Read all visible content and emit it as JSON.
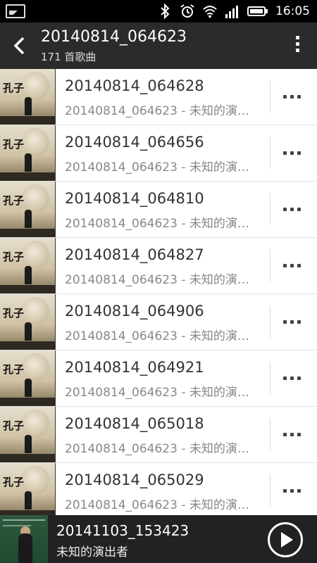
{
  "status_bar": {
    "time": "16:05",
    "icons": [
      "gallery-icon",
      "bluetooth-icon",
      "alarm-icon",
      "wifi-icon",
      "signal-icon",
      "battery-icon"
    ]
  },
  "header": {
    "title": "20140814_064623",
    "subtitle": "171 首歌曲"
  },
  "songs": [
    {
      "title": "20140814_064628",
      "detail": "20140814_064623 - 未知的演…"
    },
    {
      "title": "20140814_064656",
      "detail": "20140814_064623 - 未知的演…"
    },
    {
      "title": "20140814_064810",
      "detail": "20140814_064623 - 未知的演…"
    },
    {
      "title": "20140814_064827",
      "detail": "20140814_064623 - 未知的演…"
    },
    {
      "title": "20140814_064906",
      "detail": "20140814_064623 - 未知的演…"
    },
    {
      "title": "20140814_064921",
      "detail": "20140814_064623 - 未知的演…"
    },
    {
      "title": "20140814_065018",
      "detail": "20140814_064623 - 未知的演…"
    },
    {
      "title": "20140814_065029",
      "detail": "20140814_064623 - 未知的演…"
    }
  ],
  "album_art_text": "孔子",
  "now_playing": {
    "title": "20141103_153423",
    "artist": "未知的演出者"
  },
  "colors": {
    "header_bg": "#2b2b2b",
    "status_bg": "#000000",
    "nowbar_bg": "#222222",
    "title_text": "#333333",
    "detail_text": "#888888"
  }
}
